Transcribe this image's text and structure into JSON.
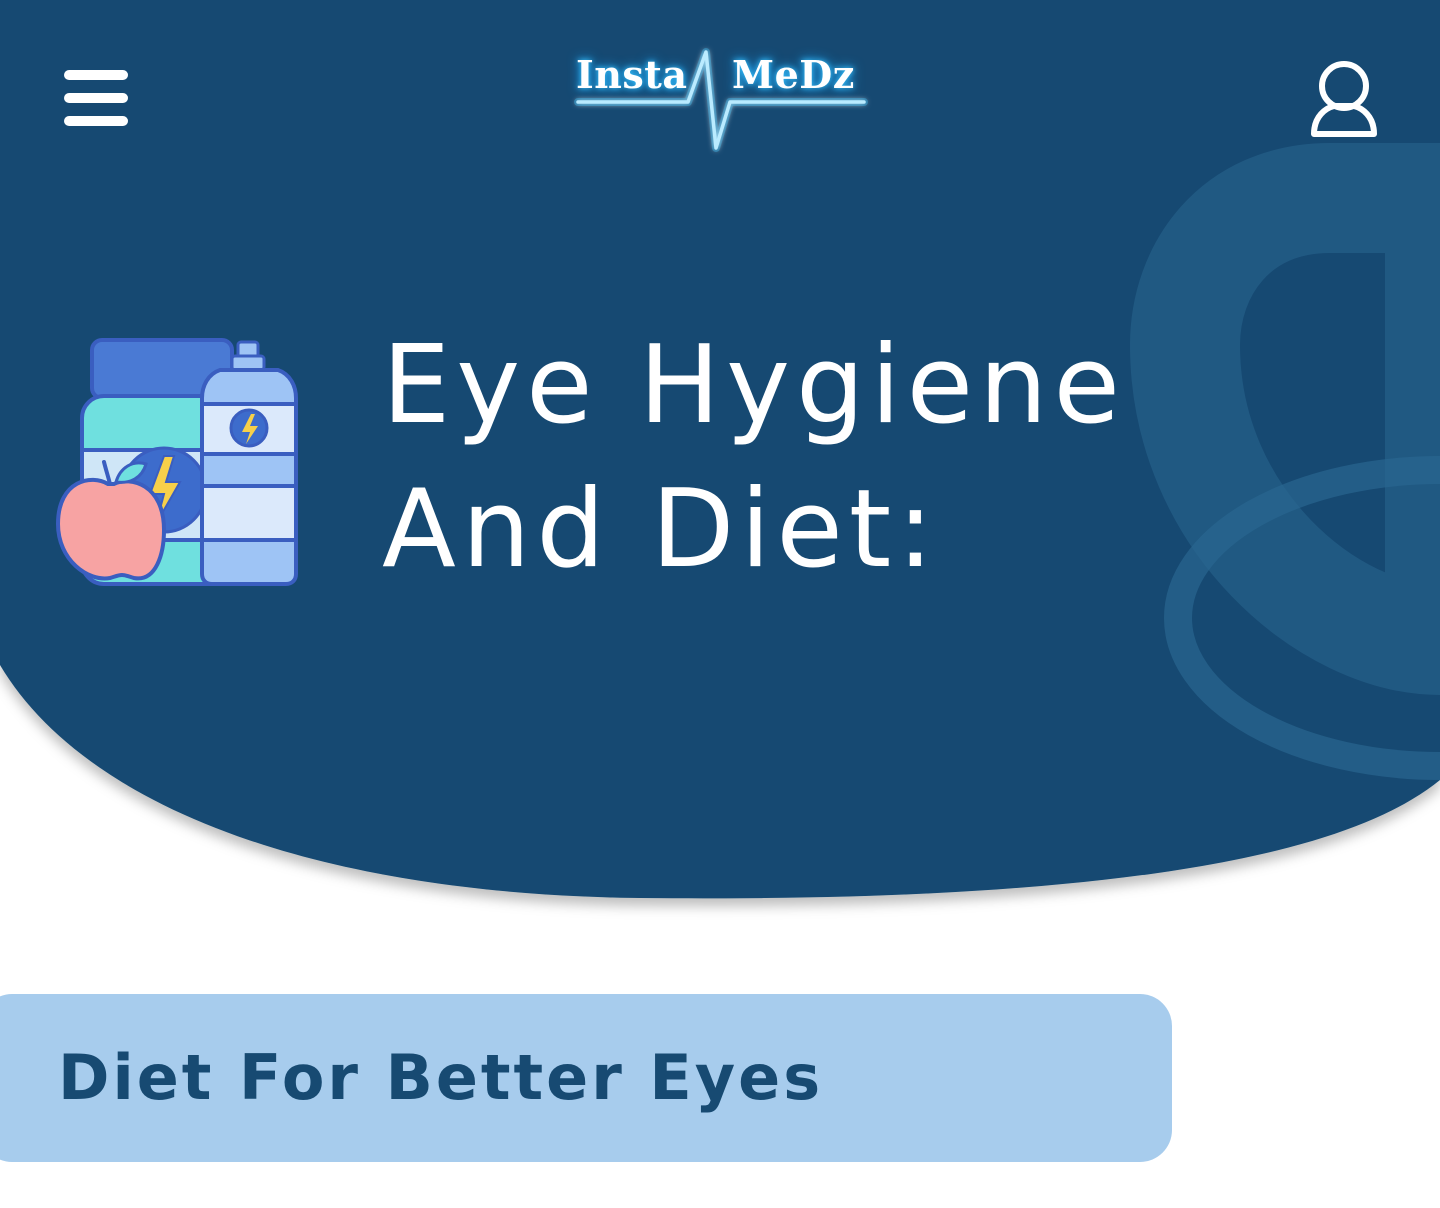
{
  "header": {
    "menu_icon": "hamburger-menu-icon",
    "logo": {
      "left_word": "Insta",
      "right_word": "MeDz",
      "pulse_icon": "heartbeat-line-icon"
    },
    "profile_icon": "user-profile-icon"
  },
  "hero": {
    "illustration_icon": "nutrition-supplement-jar-apple-water-bottle-icon",
    "title_line1": "Eye Hygiene",
    "title_line2": "And Diet:"
  },
  "section": {
    "title": "Diet For Better Eyes"
  },
  "colors": {
    "hero_background": "#174a72",
    "hero_decor_rings": "#2a6690",
    "section_banner": "#a7cced",
    "section_text": "#174a72",
    "logo_glow": "#39c6ff",
    "text_light": "#ffffff"
  }
}
